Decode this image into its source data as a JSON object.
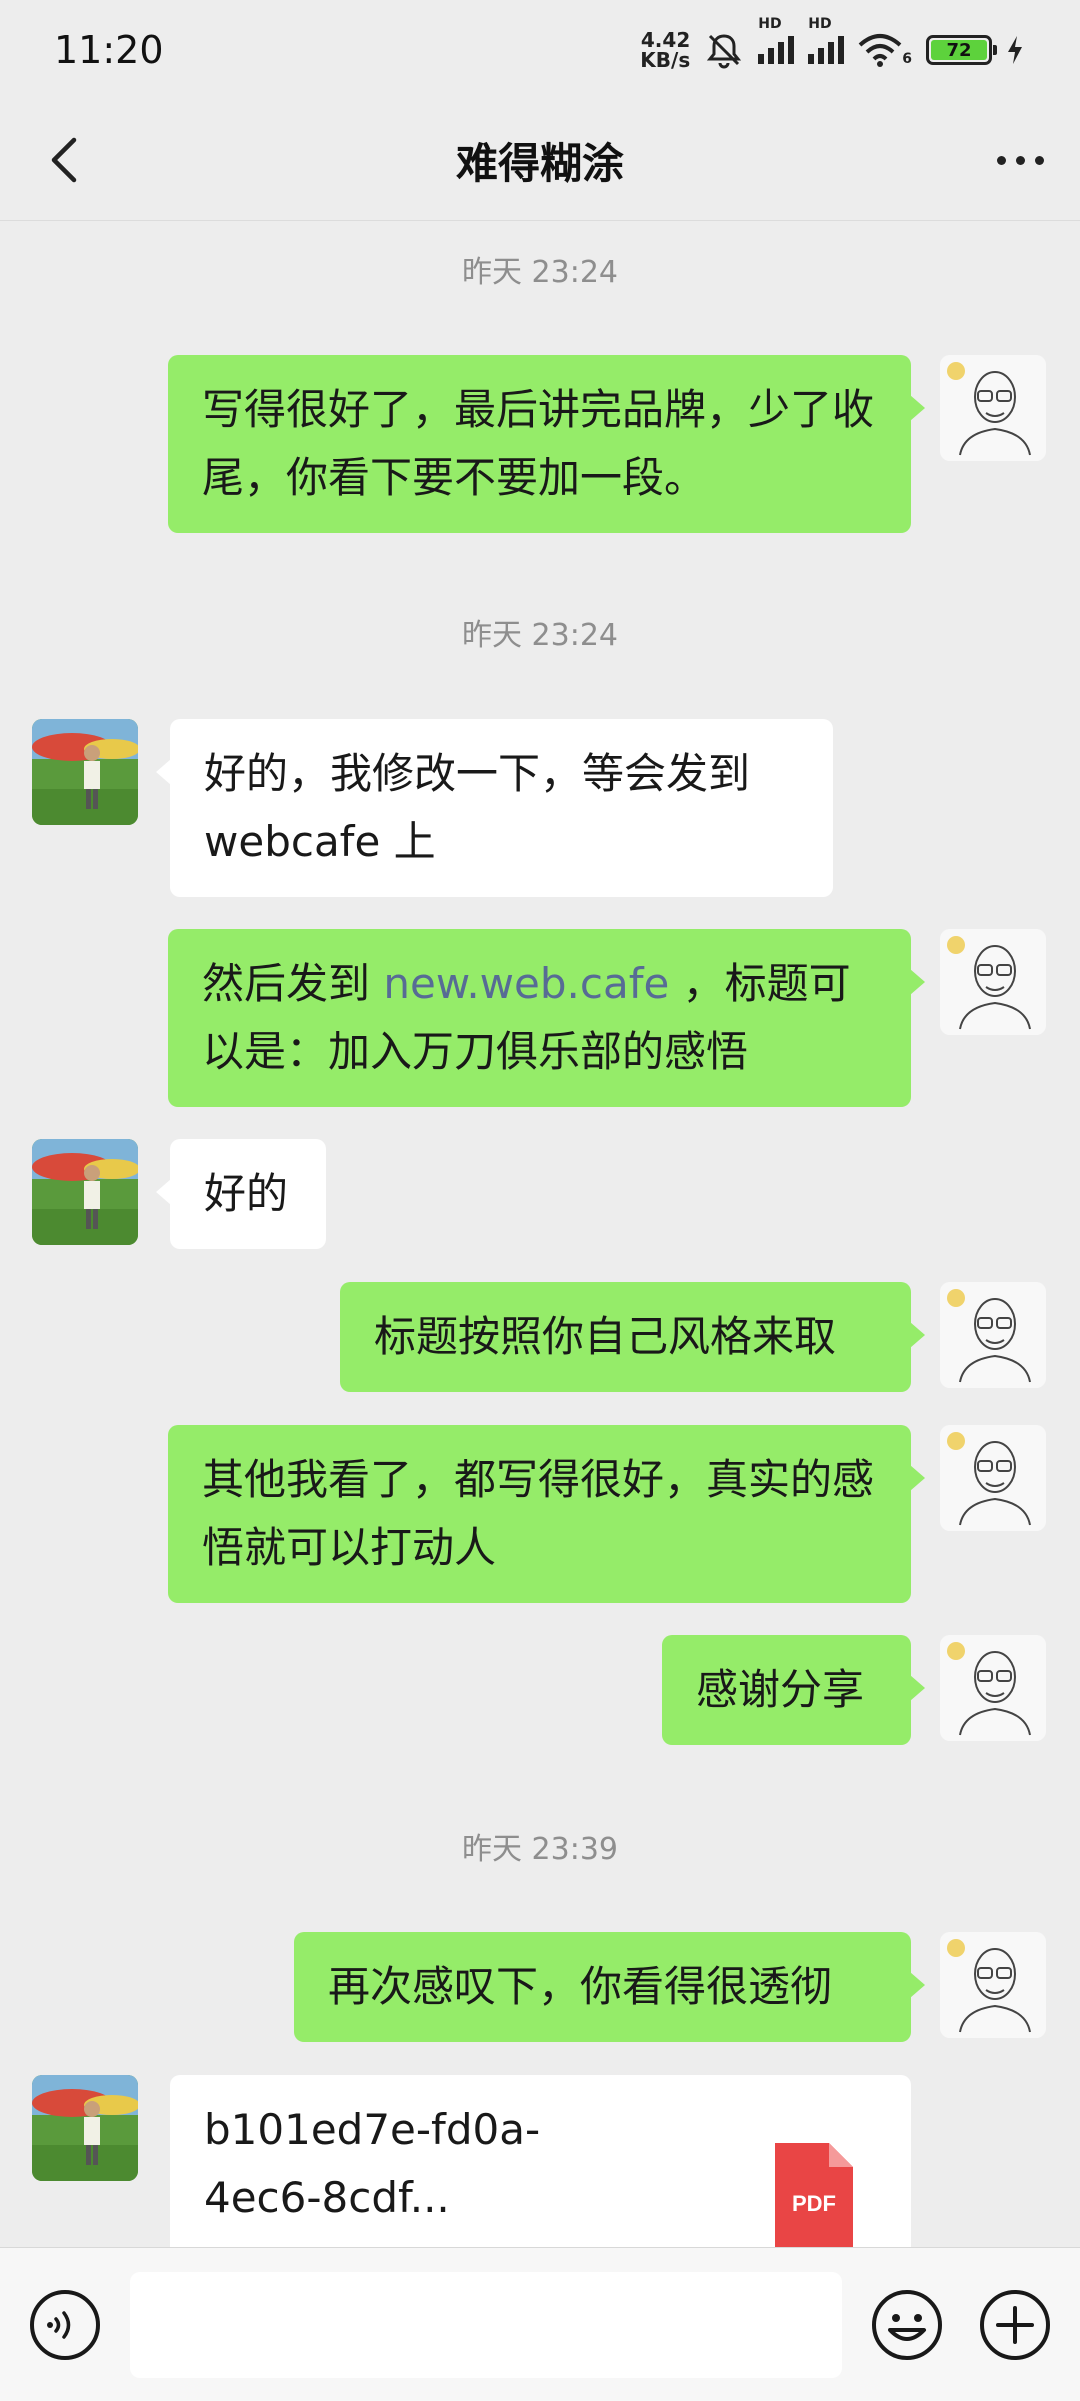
{
  "status_bar": {
    "time": "11:20",
    "net_speed_value": "4.42",
    "net_speed_unit": "KB/s",
    "signal_label_1": "HD",
    "signal_label_2": "HD",
    "wifi_label": "6",
    "battery": "72",
    "icons": [
      "mute-bell-icon",
      "signal-icon",
      "signal-icon",
      "wifi-icon",
      "battery-icon",
      "charging-icon"
    ]
  },
  "header": {
    "title": "难得糊涂",
    "back_icon": "chevron-left-icon",
    "more_icon": "more-dots-icon"
  },
  "colors": {
    "me_bubble": "#95ec69",
    "other_bubble": "#ffffff",
    "background": "#ededed",
    "link": "#576b95",
    "timestamp": "#8e8e8e",
    "pdf": "#e94545"
  },
  "messages": {
    "ts1": "昨天 23:24",
    "m1": "写得很好了，最后讲完品牌，少了收尾，你看下要不要加一段。",
    "ts2": "昨天 23:24",
    "m2": "好的，我修改一下，等会发到webcafe 上",
    "m3_prefix": "然后发到 ",
    "m3_link": "new.web.cafe",
    "m3_suffix": " ，标题可以是：加入万刀俱乐部的感悟",
    "m4": "好的",
    "m5": "标题按照你自己风格来取",
    "m6": "其他我看了，都写得很好，真实的感悟就可以打动人",
    "m7": "感谢分享",
    "ts3": "昨天 23:39",
    "m8": "再次感叹下，你看得很透彻",
    "file_name": "b101ed7e-fd0a-4ec6-8cdf...",
    "file_type": "PDF"
  },
  "input_bar": {
    "voice_icon": "voice-icon",
    "emoji_icon": "emoji-icon",
    "plus_icon": "plus-icon",
    "input_value": ""
  }
}
